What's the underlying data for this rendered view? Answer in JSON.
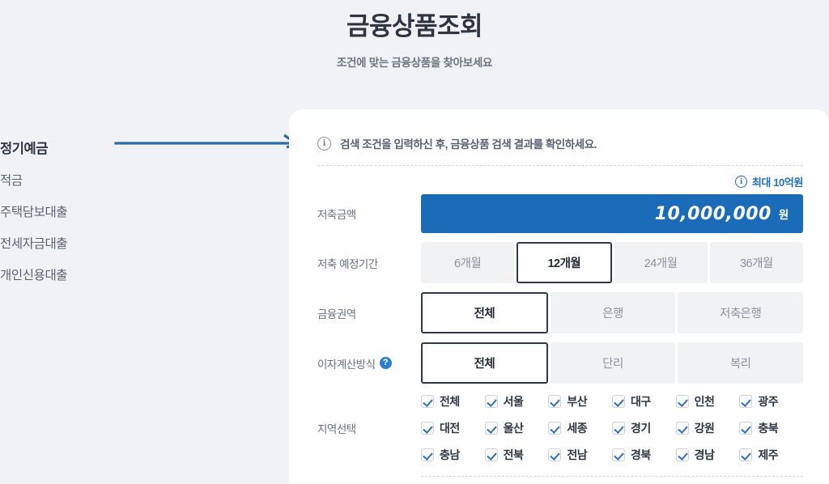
{
  "header": {
    "title": "금융상품조회",
    "subtitle": "조건에 맞는 금융상품을 찾아보세요"
  },
  "sidebar": {
    "items": [
      {
        "label": "정기예금",
        "active": true
      },
      {
        "label": "적금",
        "active": false
      },
      {
        "label": "주택담보대출",
        "active": false
      },
      {
        "label": "전세자금대출",
        "active": false
      },
      {
        "label": "개인신용대출",
        "active": false
      }
    ]
  },
  "annotation": {
    "arrow_color": "#2b6cb0"
  },
  "card": {
    "info_banner": {
      "icon": "info-circle-icon",
      "text": "검색 조건을 입력하신 후, 금융상품 검색 결과를 확인하세요."
    },
    "amount_hint": {
      "icon": "info-circle-icon",
      "text": "최대 10억원",
      "color": "#1e6fc0"
    },
    "rows": {
      "amount": {
        "label": "저축금액",
        "value": "10,000,000",
        "placeholder": "0",
        "unit": "원",
        "fill_color": "#1b6cb8"
      },
      "period": {
        "label": "저축 예정기간",
        "options": [
          {
            "label": "6개월",
            "selected": false
          },
          {
            "label": "12개월",
            "selected": true
          },
          {
            "label": "24개월",
            "selected": false
          },
          {
            "label": "36개월",
            "selected": false
          }
        ]
      },
      "sector": {
        "label": "금융권역",
        "options": [
          {
            "label": "전체",
            "selected": true
          },
          {
            "label": "은행",
            "selected": false
          },
          {
            "label": "저축은행",
            "selected": false
          }
        ]
      },
      "interest": {
        "label": "이자계산방식",
        "help_icon": "question-mark-icon",
        "options": [
          {
            "label": "전체",
            "selected": true
          },
          {
            "label": "단리",
            "selected": false
          },
          {
            "label": "복리",
            "selected": false
          }
        ]
      },
      "region": {
        "label": "지역선택",
        "items": [
          {
            "label": "전체",
            "checked": true
          },
          {
            "label": "서울",
            "checked": true
          },
          {
            "label": "부산",
            "checked": true
          },
          {
            "label": "대구",
            "checked": true
          },
          {
            "label": "인천",
            "checked": true
          },
          {
            "label": "광주",
            "checked": true
          },
          {
            "label": "대전",
            "checked": true
          },
          {
            "label": "울산",
            "checked": true
          },
          {
            "label": "세종",
            "checked": true
          },
          {
            "label": "경기",
            "checked": true
          },
          {
            "label": "강원",
            "checked": true
          },
          {
            "label": "충북",
            "checked": true
          },
          {
            "label": "충남",
            "checked": true
          },
          {
            "label": "전북",
            "checked": true
          },
          {
            "label": "전남",
            "checked": true
          },
          {
            "label": "경북",
            "checked": true
          },
          {
            "label": "경남",
            "checked": true
          },
          {
            "label": "제주",
            "checked": true
          }
        ]
      }
    }
  }
}
